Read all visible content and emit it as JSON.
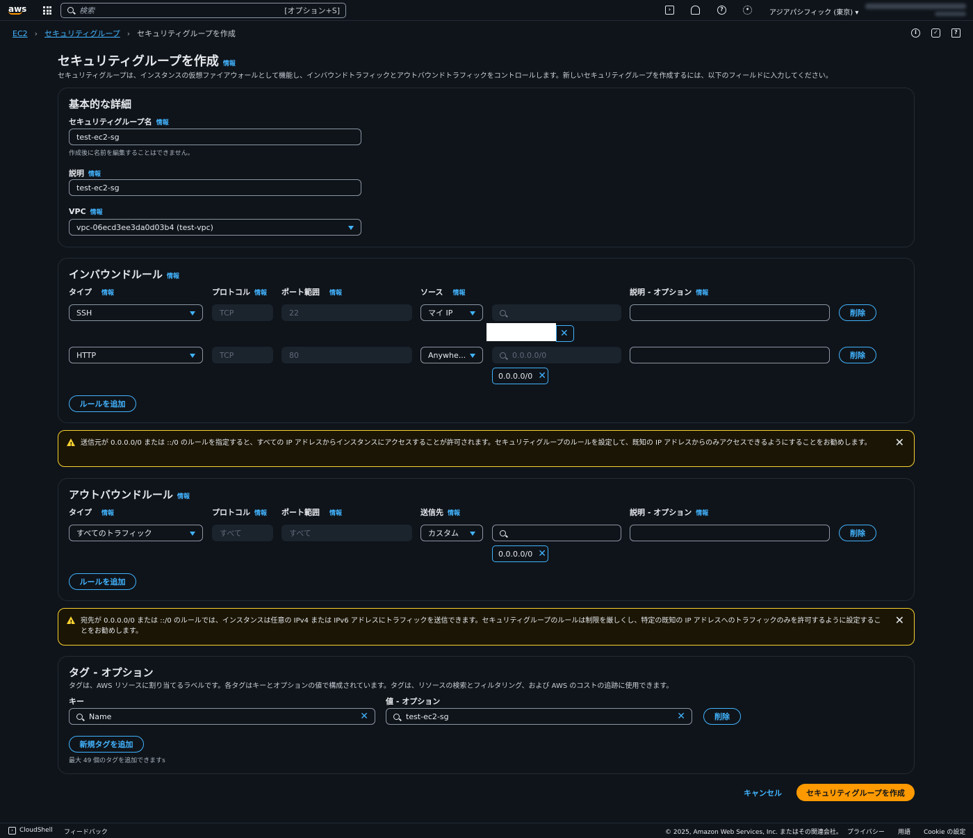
{
  "topbar": {
    "logo": "aws",
    "search_placeholder": "検索",
    "search_shortcut": "[オプション+S]",
    "region": "アジアパシフィック (東京) ▾"
  },
  "breadcrumb": {
    "ec2": "EC2",
    "sg": "セキュリティグループ",
    "current": "セキュリティグループを作成"
  },
  "page": {
    "title": "セキュリティグループを作成",
    "info": "情報",
    "description": "セキュリティグループは、インスタンスの仮想ファイアウォールとして機能し、インバウンドトラフィックとアウトバウンドトラフィックをコントロールします。新しいセキュリティグループを作成するには、以下のフィールドに入力してください。"
  },
  "basic": {
    "heading": "基本的な詳細",
    "name_label": "セキュリティグループ名",
    "name_value": "test-ec2-sg",
    "name_hint": "作成後に名前を編集することはできません。",
    "desc_label": "説明",
    "desc_value": "test-ec2-sg",
    "vpc_label": "VPC",
    "vpc_value": "vpc-06ecd3ee3da0d03b4 (test-vpc)"
  },
  "inbound": {
    "heading": "インバウンドルール",
    "col_type": "タイプ",
    "col_protocol": "プロトコル",
    "col_port": "ポート範囲",
    "col_source": "ソース",
    "col_desc": "説明 - オプション",
    "rows": [
      {
        "type": "SSH",
        "protocol": "TCP",
        "port": "22",
        "source": "マイ IP",
        "search": "",
        "token": ""
      },
      {
        "type": "HTTP",
        "protocol": "TCP",
        "port": "80",
        "source": "Anywhe...",
        "search": "0.0.0.0/0",
        "token": "0.0.0.0/0"
      }
    ],
    "delete": "削除",
    "add_rule": "ルールを追加"
  },
  "warning1": "送信元が 0.0.0.0/0 または ::/0 のルールを指定すると、すべての IP アドレスからインスタンスにアクセスすることが許可されます。セキュリティグループのルールを設定して、既知の IP アドレスからのみアクセスできるようにすることをお勧めします。",
  "outbound": {
    "heading": "アウトバウンドルール",
    "col_type": "タイプ",
    "col_protocol": "プロトコル",
    "col_port": "ポート範囲",
    "col_dest": "送信先",
    "col_desc": "説明 - オプション",
    "row": {
      "type": "すべてのトラフィック",
      "protocol": "すべて",
      "port": "すべて",
      "dest": "カスタム",
      "token": "0.0.0.0/0"
    },
    "delete": "削除",
    "add_rule": "ルールを追加"
  },
  "warning2": "宛先が 0.0.0.0/0 または ::/0 のルールでは、インスタンスは任意の IPv4 または IPv6 アドレスにトラフィックを送信できます。セキュリティグループのルールは制限を厳しくし、特定の既知の IP アドレスへのトラフィックのみを許可するように設定することをお勧めします。",
  "tags": {
    "heading": "タグ - オプション",
    "description": "タグは、AWS リソースに割り当てるラベルです。各タグはキーとオプションの値で構成されています。タグは、リソースの検索とフィルタリング、および AWS のコストの追跡に使用できます。",
    "key_label": "キー",
    "value_label": "値 - オプション",
    "key_value": "Name",
    "value_value": "test-ec2-sg",
    "delete": "削除",
    "add_tag": "新規タグを追加",
    "limit": "最大 49 個のタグを追加できます​s"
  },
  "actions": {
    "cancel": "キャンセル",
    "create": "セキュリティグループを作成"
  },
  "footer": {
    "cloudshell": "CloudShell",
    "feedback": "フィードバック",
    "copyright": "© 2025, Amazon Web Services, Inc. またはその関連会社。",
    "privacy": "プライバシー",
    "terms": "用語",
    "cookie": "Cookie の設定"
  }
}
